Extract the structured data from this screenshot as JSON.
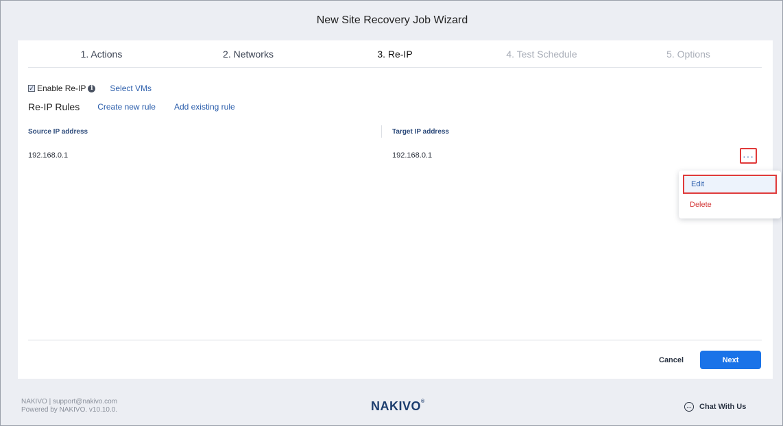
{
  "window": {
    "title": "New Site Recovery Job Wizard"
  },
  "steps": [
    {
      "label": "1. Actions",
      "state": "done"
    },
    {
      "label": "2. Networks",
      "state": "done"
    },
    {
      "label": "3. Re-IP",
      "state": "active"
    },
    {
      "label": "4. Test Schedule",
      "state": "disabled"
    },
    {
      "label": "5. Options",
      "state": "disabled"
    }
  ],
  "reip": {
    "enable_label": "Enable Re-IP",
    "enabled": true,
    "checkbox_glyph": "✓",
    "info_icon": "i",
    "select_vms_label": "Select VMs",
    "rules_title": "Re-IP Rules",
    "create_rule_label": "Create new rule",
    "add_existing_label": "Add existing rule"
  },
  "table": {
    "columns": [
      "Source IP address",
      "Target IP address"
    ],
    "rows": [
      {
        "source": "192.168.0.1",
        "target": "192.168.0.1"
      }
    ],
    "more_glyph": "···"
  },
  "context_menu": {
    "items": [
      {
        "label": "Edit"
      },
      {
        "label": "Delete"
      }
    ]
  },
  "actions": {
    "cancel_label": "Cancel",
    "next_label": "Next"
  },
  "footer": {
    "line1": "NAKIVO | support@nakivo.com",
    "line2": "Powered by NAKIVO. v10.10.0.",
    "brand": "NAKIVO",
    "brand_mark": "®",
    "chat_label": "Chat With Us",
    "chat_icon_glyph": "…"
  },
  "colors": {
    "accent": "#1a73e8",
    "link": "#2a5dab",
    "highlight_border": "#e03a3a",
    "delete": "#d43a3a"
  }
}
